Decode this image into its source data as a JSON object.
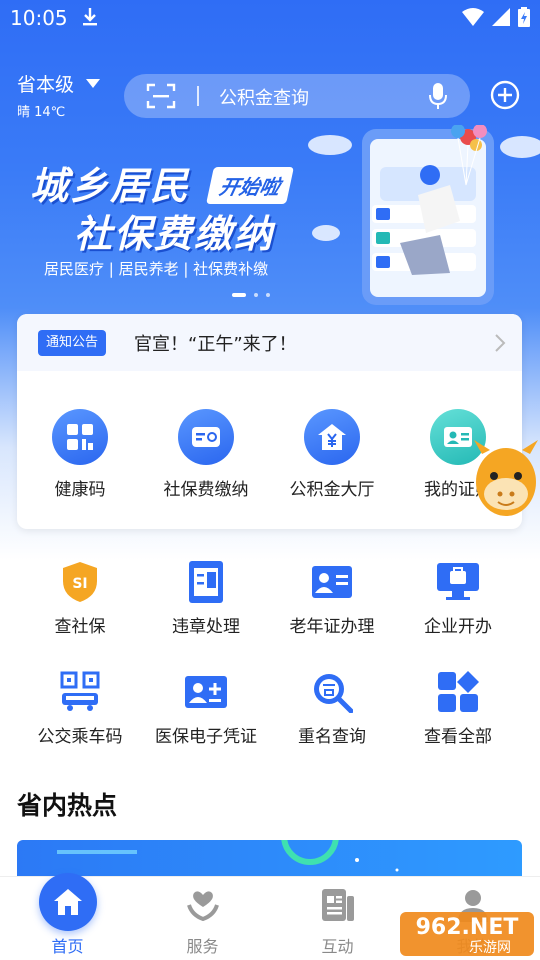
{
  "status_bar": {
    "time": "10:05"
  },
  "location": {
    "name": "省本级",
    "weather": "晴 14℃"
  },
  "search": {
    "placeholder": "公积金查询"
  },
  "banner": {
    "title_line1": "城乡居民",
    "badge": "开始啦",
    "title_line2": "社保费缴纳",
    "subtitle": "居民医疗 | 居民养老 | 社保费补缴"
  },
  "notice": {
    "tag": "通知公告",
    "text": "官宣！“正午”来了！"
  },
  "quick_actions": [
    {
      "label": "健康码",
      "icon": "health-code-icon"
    },
    {
      "label": "社保费缴纳",
      "icon": "social-insurance-card-icon"
    },
    {
      "label": "公积金大厅",
      "icon": "housing-fund-icon"
    },
    {
      "label": "我的证照",
      "icon": "id-card-icon"
    }
  ],
  "services": [
    {
      "label": "查社保",
      "icon": "shield-icon"
    },
    {
      "label": "违章处理",
      "icon": "traffic-ticket-icon"
    },
    {
      "label": "老年证办理",
      "icon": "elder-card-icon"
    },
    {
      "label": "企业开办",
      "icon": "briefcase-monitor-icon"
    },
    {
      "label": "公交乘车码",
      "icon": "bus-qr-icon"
    },
    {
      "label": "医保电子凭证",
      "icon": "medical-insurance-icon"
    },
    {
      "label": "重名查询",
      "icon": "name-search-icon"
    },
    {
      "label": "查看全部",
      "icon": "grid-all-icon"
    }
  ],
  "section": {
    "hot_title": "省内热点"
  },
  "bottom_nav": [
    {
      "label": "首页",
      "icon": "home-icon",
      "active": true
    },
    {
      "label": "服务",
      "icon": "service-heart-icon",
      "active": false
    },
    {
      "label": "互动",
      "icon": "interact-doc-icon",
      "active": false
    },
    {
      "label": "我的",
      "icon": "user-icon",
      "active": false
    }
  ],
  "watermark": {
    "text": "962.NET",
    "subtext": "乐游网"
  },
  "colors": {
    "accent": "#2f6df5",
    "teal": "#24b9b5",
    "orange": "#f5a623"
  }
}
